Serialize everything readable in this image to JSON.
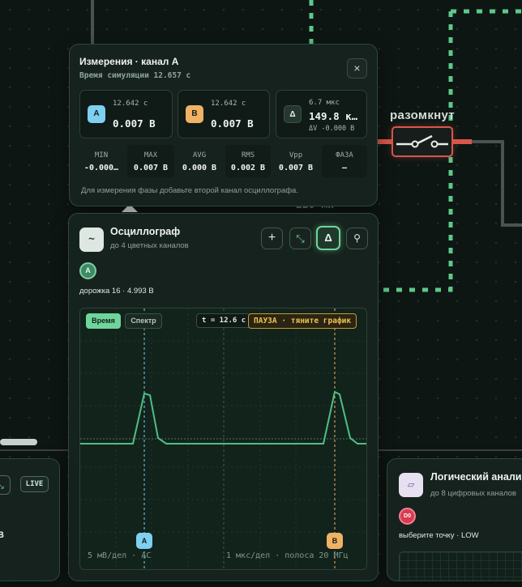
{
  "switch": {
    "label": "разомкнут"
  },
  "background_text": {
    "partial_label": "220 мк"
  },
  "measurement": {
    "title": "Измерения · канал A",
    "subtitle": "Время симуляции 12.657 с",
    "close": "×",
    "cursor_a": {
      "badge": "A",
      "time": "12.642 с",
      "value": "0.007 В"
    },
    "cursor_b": {
      "badge": "B",
      "time": "12.642 с",
      "value": "0.007 В"
    },
    "delta": {
      "badge": "Δ",
      "time": "6.7 мкс",
      "value": "149.8 к…",
      "dv": "ΔV -0.000 В"
    },
    "stats": [
      {
        "label": "MIN",
        "value": "-0.000…"
      },
      {
        "label": "MAX",
        "value": "0.007 В"
      },
      {
        "label": "AVG",
        "value": "0.000 В"
      },
      {
        "label": "RMS",
        "value": "0.002 В"
      },
      {
        "label": "Vpp",
        "value": "0.007 В"
      },
      {
        "label": "ФАЗА",
        "value": "—"
      }
    ],
    "note": "Для измерения фазы добавьте второй канал осциллографа."
  },
  "oscilloscope": {
    "icon": "~",
    "title": "Осциллограф",
    "subtitle": "до 4 цветных каналов",
    "toolbar": {
      "add": "+",
      "collapse": "⤡",
      "delta": "Δ",
      "probe": "⚲"
    },
    "channel_badge": "A",
    "track": "дорожка 16 · 4.993 В",
    "mode_time": "Время",
    "mode_spectrum": "Спектр",
    "time_label": "t = 12.6 с",
    "pause_label": "ПАУЗА · тяните график",
    "cursor_a": "A",
    "cursor_b": "B",
    "footer_left": "5 мВ/дел · AC",
    "footer_right": "1 мкс/дел · полоса 20 МГц",
    "colors": {
      "trace": "#4fbf82",
      "cursor_a": "#7ed0f0",
      "cursor_b": "#f0b264",
      "accent": "#6fd59b"
    }
  },
  "left_panel": {
    "live": "LIVE",
    "value_partial": "В"
  },
  "logic": {
    "icon": "▱",
    "title": "Логический анализатор",
    "subtitle": "до 8 цифровых каналов",
    "channel_badge": "D0",
    "point": "выберите точку · LOW"
  }
}
